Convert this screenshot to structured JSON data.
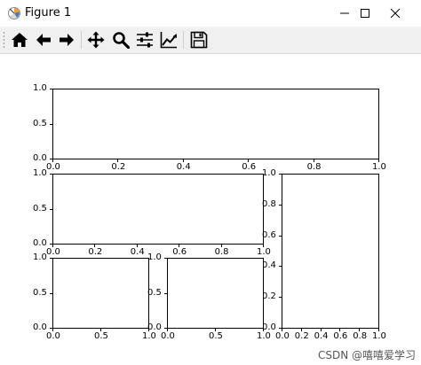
{
  "window": {
    "title": "Figure 1",
    "controls": [
      "minimize-icon",
      "maximize-icon",
      "close-icon"
    ]
  },
  "toolbar": {
    "buttons": [
      {
        "name": "home-icon"
      },
      {
        "name": "back-arrow-icon"
      },
      {
        "name": "forward-arrow-icon"
      },
      {
        "name": "pan-icon"
      },
      {
        "name": "zoom-icon"
      },
      {
        "name": "configure-subplots-icon"
      },
      {
        "name": "edit-axes-icon"
      },
      {
        "name": "save-icon"
      }
    ]
  },
  "chart_data": [
    {
      "type": "line",
      "x_ticks": [
        "0.0",
        "0.2",
        "0.4",
        "0.6",
        "0.8",
        "1.0"
      ],
      "y_ticks": [
        "0.0",
        "0.5",
        "1.0"
      ],
      "xlim": [
        0,
        1
      ],
      "ylim": [
        0,
        1
      ]
    },
    {
      "type": "line",
      "x_ticks": [
        "0.0",
        "0.2",
        "0.4",
        "0.6",
        "0.8",
        "1.0"
      ],
      "y_ticks": [
        "0.0",
        "0.5",
        "1.0"
      ],
      "xlim": [
        0,
        1
      ],
      "ylim": [
        0,
        1
      ]
    },
    {
      "type": "line",
      "x_ticks": [
        "0.0",
        "0.2",
        "0.4",
        "0.6",
        "0.8",
        "1.0"
      ],
      "y_ticks": [
        "0.0",
        "0.2",
        "0.4",
        "0.6",
        "0.8",
        "1.0"
      ],
      "xlim": [
        0,
        1
      ],
      "ylim": [
        0,
        1
      ]
    },
    {
      "type": "line",
      "x_ticks": [
        "0.0",
        "0.5",
        "1.0"
      ],
      "y_ticks": [
        "0.0",
        "0.5",
        "1.0"
      ],
      "xlim": [
        0,
        1
      ],
      "ylim": [
        0,
        1
      ]
    },
    {
      "type": "line",
      "x_ticks": [
        "0.0",
        "0.5",
        "1.0"
      ],
      "y_ticks": [
        "0.0",
        "0.5",
        "1.0"
      ],
      "xlim": [
        0,
        1
      ],
      "ylim": [
        0,
        1
      ]
    }
  ],
  "watermark": "CSDN @嘻嘻爱学习"
}
